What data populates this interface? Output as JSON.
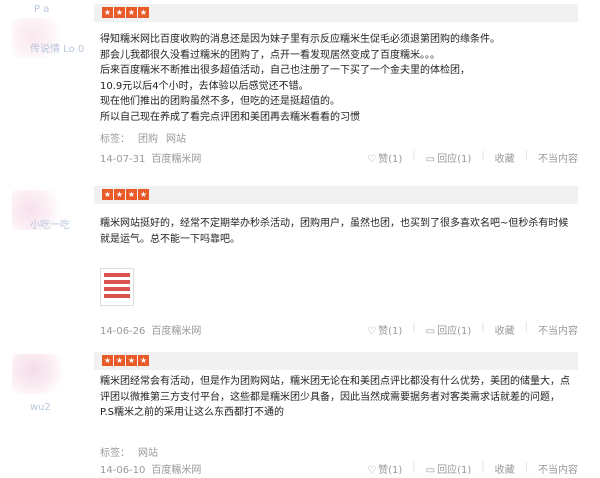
{
  "reviews": [
    {
      "username_top": "P a",
      "username": "传说情 Lo 0",
      "stars": 4,
      "content": [
        "得知糯米网比百度收购的消息还是因为妹子里有示反应糯米生促毛必须退第团购的缘条件。",
        "那会儿我都很久没看过糯米的团购了，点开一看发现居然变成了百度糯米。。。",
        "后来百度糯米不断推出很多超值活动，自己也注册了一下买了一个金夫里的体检团，",
        "10.9元以后4个小时，去体验以后感觉还不错。",
        "现在他们推出的团购虽然不多，但吃的还是挺超值的。",
        "所以自己现在养成了看完点评团和美团再去糯米看看的习惯"
      ],
      "tags_label": "标签：",
      "tags": [
        "团购",
        "网站"
      ],
      "date": "14-07-31",
      "source": "百度糯米网",
      "like": "赞(1)",
      "reply": "回应(1)",
      "collect": "收藏",
      "report": "不当内容"
    },
    {
      "username": "小吃一吃",
      "stars": 4,
      "content": [
        "糯米网站挺好的，经常不定期举办秒杀活动，团购用户，虽然也团，也买到了很多喜欢名吧~但秒杀有时候就是运气。总不能一下吗靠吧。"
      ],
      "date": "14-06-26",
      "source": "百度糯米网",
      "like": "赞(1)",
      "reply": "回应(1)",
      "collect": "收藏",
      "report": "不当内容"
    },
    {
      "username": "wu2",
      "stars": 4,
      "content": [
        "糯米团经常会有活动，但是作为团购网站，糯米团无论在和美团点评比都没有什么优势，美团的储量大，点评团以微推第三方支付平台，这些都是糯米团少具备，因此当然成需要据务者对客类需求话就差的问题，P.S糯米之前的采用让这么东西都打不通的"
      ],
      "tags_label": "标签：",
      "tags": [
        "网站"
      ],
      "date": "14-06-10",
      "source": "百度糯米网",
      "like": "赞(1)",
      "reply": "回应(1)",
      "collect": "收藏",
      "report": "不当内容"
    }
  ],
  "icons": {
    "like": "thumbs-up-icon",
    "reply": "comment-icon",
    "star": "star-icon"
  },
  "colors": {
    "star": "#e85a28",
    "meta": "#999999",
    "username": "#b9c7dc"
  }
}
